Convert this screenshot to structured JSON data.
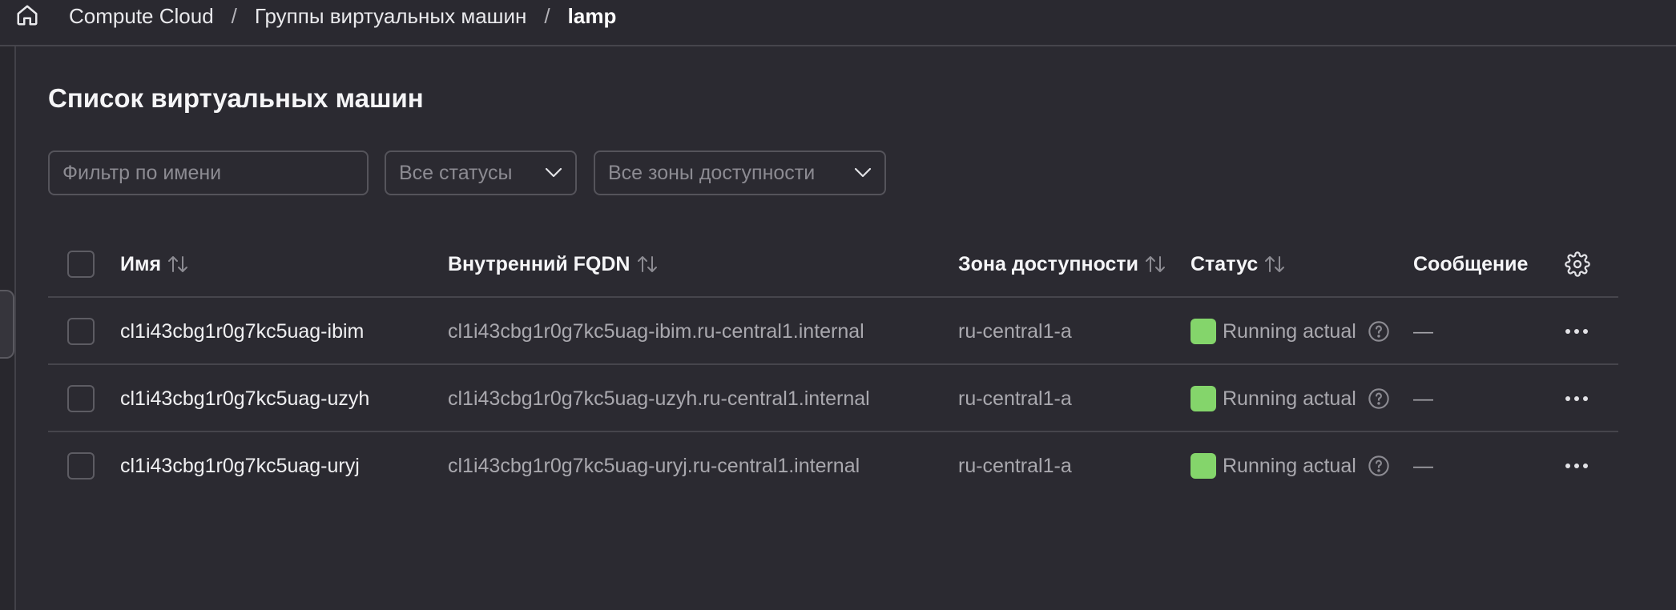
{
  "breadcrumb": {
    "items": [
      "Compute Cloud",
      "Группы виртуальных машин"
    ],
    "current": "lamp",
    "separator": "/"
  },
  "page": {
    "title": "Список виртуальных машин"
  },
  "filters": {
    "name_placeholder": "Фильтр по имени",
    "status_value": "Все статусы",
    "zone_value": "Все зоны доступности"
  },
  "table": {
    "columns": {
      "name": "Имя",
      "fqdn": "Внутренний FQDN",
      "zone": "Зона доступности",
      "status": "Статус",
      "message": "Сообщение"
    },
    "rows": [
      {
        "name": "cl1i43cbg1r0g7kc5uag-ibim",
        "fqdn": "cl1i43cbg1r0g7kc5uag-ibim.ru-central1.internal",
        "zone": "ru-central1-a",
        "status": "Running actual",
        "message": "—"
      },
      {
        "name": "cl1i43cbg1r0g7kc5uag-uzyh",
        "fqdn": "cl1i43cbg1r0g7kc5uag-uzyh.ru-central1.internal",
        "zone": "ru-central1-a",
        "status": "Running actual",
        "message": "—"
      },
      {
        "name": "cl1i43cbg1r0g7kc5uag-uryj",
        "fqdn": "cl1i43cbg1r0g7kc5uag-uryj.ru-central1.internal",
        "zone": "ru-central1-a",
        "status": "Running actual",
        "message": "—"
      }
    ]
  },
  "colors": {
    "background": "#2b2a31",
    "status_running": "#84d56b",
    "border": "#46454c"
  },
  "icons": [
    "home-icon",
    "chevron-down-icon",
    "sort-icon",
    "gear-icon",
    "help-icon",
    "more-icon"
  ]
}
